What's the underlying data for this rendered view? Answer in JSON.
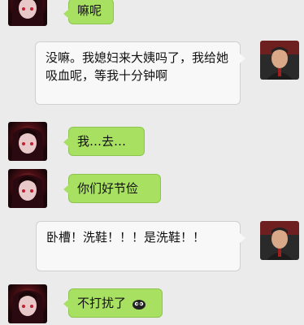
{
  "messages": [
    {
      "side": "left",
      "text": "嘛呢"
    },
    {
      "side": "right",
      "text": "没嘛。我媳妇来大姨吗了，我给她吸血呢，等我十分钟啊"
    },
    {
      "side": "left",
      "text": "我…去…"
    },
    {
      "side": "left",
      "text": "你们好节俭"
    },
    {
      "side": "right",
      "text": "卧槽！洗鞋！！！是洗鞋！！"
    },
    {
      "side": "left",
      "text": "不打扰了"
    }
  ],
  "icons": {
    "girl_avatar": "anime-girl-avatar",
    "man_avatar": "man-portrait-avatar",
    "emoji": "sheep-face-emoji"
  },
  "colors": {
    "background": "#ebebeb",
    "bubble_in": "#a8e062",
    "bubble_out": "#f8f8f8"
  }
}
